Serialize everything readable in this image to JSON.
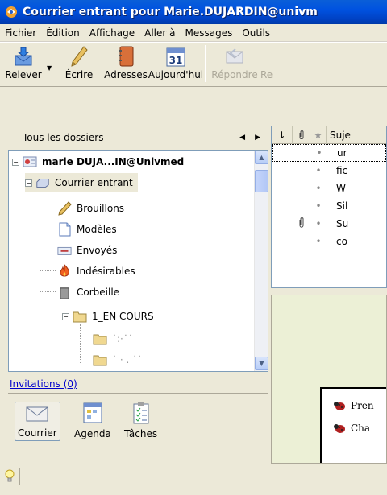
{
  "window": {
    "title": "Courrier entrant pour Marie.DUJARDIN@univm"
  },
  "menu": {
    "items": [
      "Fichier",
      "Édition",
      "Affichage",
      "Aller à",
      "Messages",
      "Outils"
    ]
  },
  "toolbar": {
    "get_mail": "Relever",
    "write": "Écrire",
    "address_book": "Adresses",
    "calendar_day": "31",
    "today": "Aujourd'hui",
    "reply": "Répondre",
    "reply_all_partial": "Re"
  },
  "folders": {
    "header": "Tous les dossiers",
    "account": "marie DUJA...IN@Univmed",
    "inbox": "Courrier entrant",
    "drafts": "Brouillons",
    "templates": "Modèles",
    "sent": "Envoyés",
    "junk": "Indésirables",
    "trash": "Corbeille",
    "en_cours": "1_EN COURS",
    "sub1": "˙:·˙˙",
    "sub2": "˙ · . ˙˙"
  },
  "invitations": "Invitations (0)",
  "nav": {
    "mail": "Courrier",
    "calendar": "Agenda",
    "tasks": "Tâches"
  },
  "messages": {
    "subject_header": "Suje",
    "rows": [
      {
        "subject": "ur",
        "attachment": false
      },
      {
        "subject": "fic",
        "attachment": false
      },
      {
        "subject": "W",
        "attachment": false
      },
      {
        "subject": "Sil",
        "attachment": false
      },
      {
        "subject": "Su",
        "attachment": true
      },
      {
        "subject": "co",
        "attachment": false
      }
    ]
  },
  "preview": {
    "line1": "Pren",
    "line2": "Cha"
  }
}
